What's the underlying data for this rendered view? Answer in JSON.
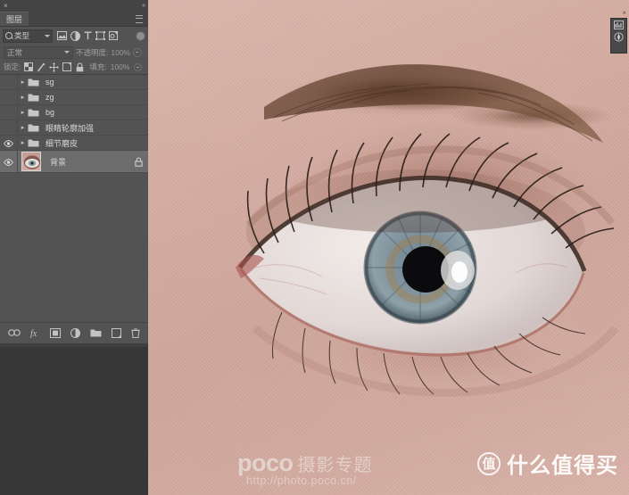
{
  "app": {
    "title": "Adobe Photoshop",
    "panel_dark_bg": "#535353",
    "canvas_bg": "#cfa9a0"
  },
  "panel": {
    "close_label": "×",
    "collapse_label": "«",
    "tab_label": "图层",
    "menu_icon": "panel-menu-icon",
    "filter": {
      "icon": "search-icon",
      "value": "类型",
      "chevron": "chevron-down-icon",
      "type_icons": [
        {
          "name": "pixel-layer-filter-icon",
          "glyph": "image"
        },
        {
          "name": "adjustment-layer-filter-icon",
          "glyph": "halfcircle"
        },
        {
          "name": "type-layer-filter-icon",
          "glyph": "T"
        },
        {
          "name": "shape-layer-filter-icon",
          "glyph": "shape"
        },
        {
          "name": "smart-object-filter-icon",
          "glyph": "smart"
        }
      ],
      "toggle_name": "filter-enable-toggle"
    },
    "blend": {
      "mode_value": "正常",
      "opacity_label": "不透明度:",
      "opacity_value": "100%"
    },
    "lock": {
      "label": "锁定:",
      "icons": [
        {
          "name": "lock-transparent-pixels-icon"
        },
        {
          "name": "lock-image-pixels-icon"
        },
        {
          "name": "lock-position-icon"
        },
        {
          "name": "lock-artboard-nesting-icon"
        },
        {
          "name": "lock-all-icon"
        }
      ],
      "fill_label": "填充:",
      "fill_value": "100%"
    },
    "layers": [
      {
        "name": "sg",
        "type": "group",
        "visible": false,
        "selected": false,
        "locked": false,
        "expanded": false
      },
      {
        "name": "zg",
        "type": "group",
        "visible": false,
        "selected": false,
        "locked": false,
        "expanded": false
      },
      {
        "name": "bg",
        "type": "group",
        "visible": false,
        "selected": false,
        "locked": false,
        "expanded": false
      },
      {
        "name": "眼睛轮廓加强",
        "type": "group",
        "visible": false,
        "selected": false,
        "locked": false,
        "expanded": false
      },
      {
        "name": "细节磨皮",
        "type": "group",
        "visible": true,
        "selected": false,
        "locked": false,
        "expanded": false
      },
      {
        "name": "背景",
        "type": "pixel",
        "visible": true,
        "selected": true,
        "locked": true,
        "expanded": false
      }
    ],
    "bottom_tools": [
      {
        "name": "link-layers-button",
        "label": "∞"
      },
      {
        "name": "layer-style-fx-button",
        "label": "fx"
      },
      {
        "name": "add-layer-mask-button",
        "label": "mask"
      },
      {
        "name": "new-adjustment-layer-button",
        "label": "adjust"
      },
      {
        "name": "new-group-button",
        "label": "folder"
      },
      {
        "name": "new-layer-button",
        "label": "new"
      },
      {
        "name": "delete-layer-button",
        "label": "trash"
      }
    ]
  },
  "mini_palette": {
    "close_label": "×",
    "icons": [
      {
        "name": "histogram-icon"
      },
      {
        "name": "navigator-icon"
      }
    ]
  },
  "watermarks": {
    "poco": {
      "brand": "poco",
      "subtitle": "摄影专题",
      "url": "http://photo.poco.cn/"
    },
    "smzdm": {
      "badge": "值",
      "text": "什么值得买"
    }
  },
  "canvas": {
    "document_name": "",
    "subject": "close-up-human-eye-retouch"
  }
}
